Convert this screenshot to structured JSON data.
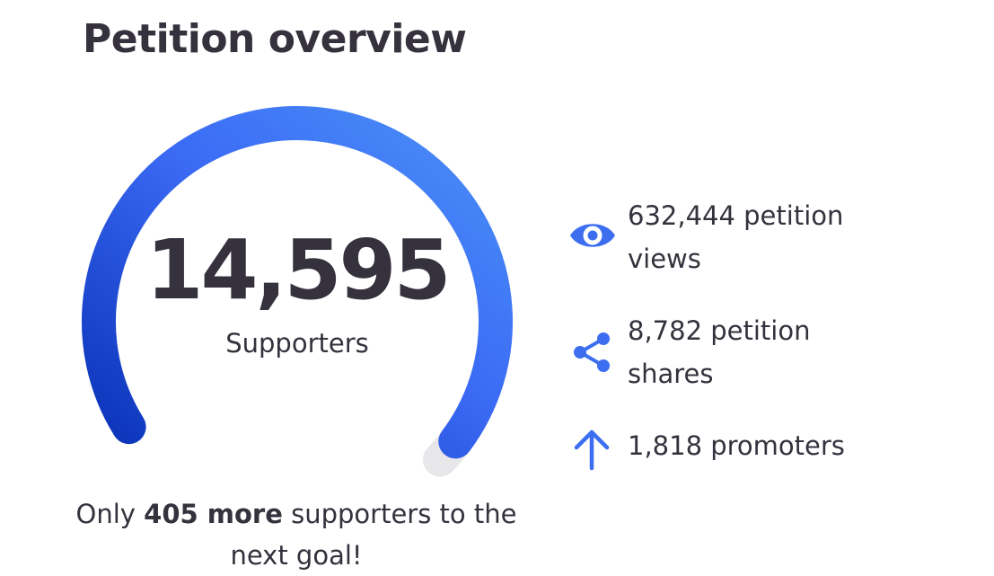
{
  "title": "Petition overview",
  "supporters": {
    "count": "14,595",
    "label": "Supporters",
    "progress": 0.973
  },
  "goal_message": {
    "prefix": "Only ",
    "highlight": "405 more",
    "suffix": " supporters to the next goal!"
  },
  "stats": {
    "views": "632,444 petition views",
    "shares": "8,782 petition shares",
    "promoters": "1,818 promoters"
  },
  "icons": {
    "views": "eye-icon",
    "shares": "share-icon",
    "promoters": "arrow-up-icon"
  },
  "colors": {
    "accent": "#3d6ef0",
    "gauge_start": "#0a33b8",
    "gauge_end": "#4a90f7",
    "track": "#e7e7e9",
    "text": "#35313d"
  }
}
